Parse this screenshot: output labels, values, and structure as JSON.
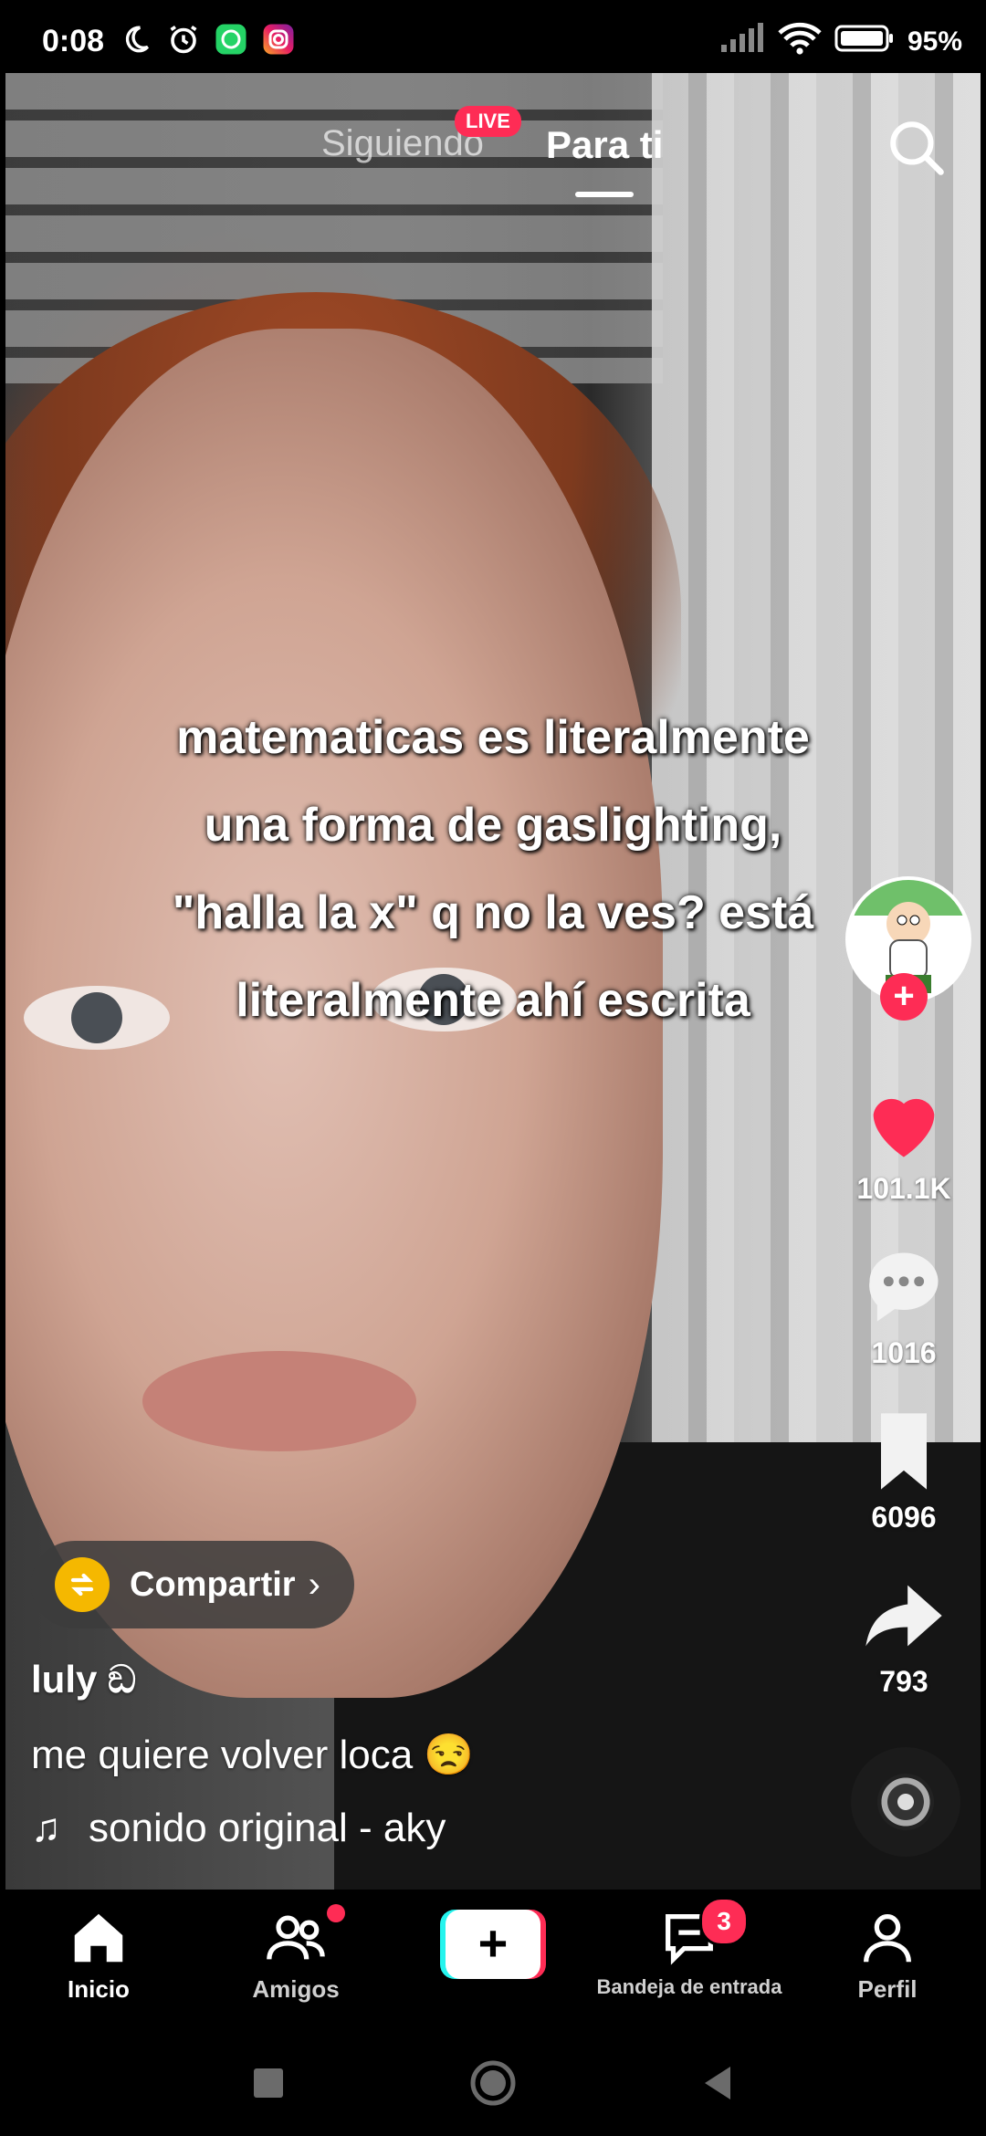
{
  "status_bar": {
    "time": "0:08",
    "battery": "95%",
    "icons": [
      "moon-icon",
      "alarm-icon",
      "whatsapp-icon",
      "instagram-icon",
      "signal-icon",
      "wifi-icon",
      "battery-icon"
    ]
  },
  "top_tabs": {
    "following": "Siguiendo",
    "for_you": "Para ti",
    "live_badge": "LIVE"
  },
  "video": {
    "overlay_text": "matematicas es literalmente una forma de gaslighting, \"halla la x\" q no la ves? está literalmente ahí escrita"
  },
  "actions": {
    "likes": "101.1K",
    "comments": "1016",
    "saves": "6096",
    "shares": "793"
  },
  "share_pill": {
    "label": "Compartir"
  },
  "post": {
    "username": "luly ඞ",
    "description": "me quiere volver loca 😒",
    "sound": "sonido original - aky"
  },
  "bottom_nav": {
    "home": "Inicio",
    "friends": "Amigos",
    "inbox": "Bandeja de entrada",
    "inbox_badge": "3",
    "profile": "Perfil"
  },
  "colors": {
    "accent": "#fe2c55",
    "cyan": "#25f4ee",
    "share_yellow": "#f5b800"
  }
}
